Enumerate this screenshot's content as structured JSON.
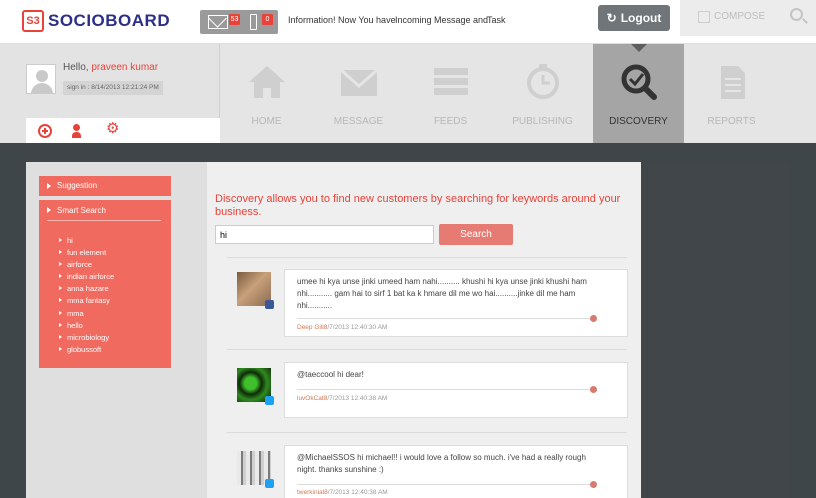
{
  "topbar": {
    "logo_badge": "S3",
    "logo_text": "SOCIOBOARD",
    "mail_count": "53",
    "alert_count": "0",
    "link_info": "Information! Now You have",
    "link_incoming": "Incoming Message and",
    "link_task": "Task",
    "logout_label": "Logout",
    "compose_label": "COMPOSE"
  },
  "user": {
    "hello": "Hello,",
    "name": "praveen kumar",
    "signin": "sign in : 8/14/2013 12:21:24 PM"
  },
  "nav": [
    {
      "label": "HOME",
      "icon": "home-icon"
    },
    {
      "label": "MESSAGE",
      "icon": "envelope-icon"
    },
    {
      "label": "FEEDS",
      "icon": "feeds-icon"
    },
    {
      "label": "PUBLISHING",
      "icon": "clock-icon"
    },
    {
      "label": "DISCOVERY",
      "icon": "magnifier-check-icon",
      "active": true
    },
    {
      "label": "REPORTS",
      "icon": "document-icon"
    }
  ],
  "sidebar": {
    "suggestion": "Suggestion",
    "smart_search": "Smart Search",
    "keywords": [
      "hi",
      "fun element",
      "airforce",
      "indian airforce",
      "anna hazare",
      "mma fantasy",
      "mma",
      "hello",
      "microbiology",
      "globussoft"
    ]
  },
  "discovery": {
    "intro": "Discovery allows you to find new customers by searching for keywords around your business.",
    "search_value": "hi",
    "search_button": "Search"
  },
  "feed": [
    {
      "text": "umee hi kya unse jinki umeed ham nahi.......... khushi hi kya unse jinki khushi ham nhi........... gam hai to sirf 1 bat ka k hmare dil me wo hai..........jinke dil me ham nhi...........",
      "author": "Deep Gill8",
      "time": "/7/2013 12:40:30 AM",
      "network": "facebook"
    },
    {
      "text": "@taeccool hi dear!",
      "author": "luvOkCat8",
      "time": "/7/2013 12:40:38 AM",
      "network": "twitter"
    },
    {
      "text": "@MichaelSSOS hi michael!! i would love a follow so much. i've had a really rough night. thanks sunshine :)",
      "author": "twerkinial8",
      "time": "/7/2013 12:40:38 AM",
      "network": "twitter"
    }
  ],
  "colors": {
    "accent": "#e8433a",
    "sidebar_red": "#f16a5f",
    "nav_active": "#a5a5a5",
    "dark_bg": "#3f4649"
  }
}
